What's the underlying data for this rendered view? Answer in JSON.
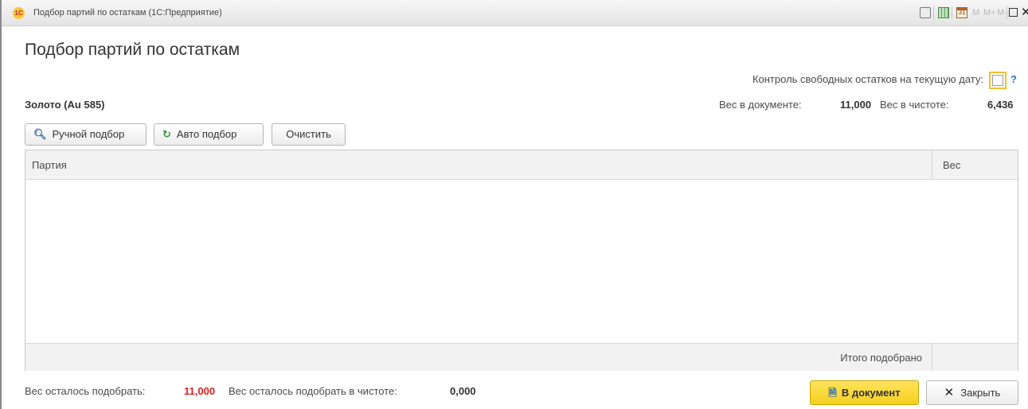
{
  "window": {
    "app_icon": "1С",
    "title": "Подбор партий по остаткам  (1С:Предприятие)",
    "icons": [
      "print-icon",
      "calculator-icon",
      "calendar-icon",
      "maximize-icon",
      "close-icon"
    ],
    "calendar_day": "31",
    "memory_buttons": [
      "M",
      "M+",
      "M-"
    ]
  },
  "form": {
    "title": "Подбор партий по остаткам",
    "control_label": "Контроль свободных остатков на текущую дату:",
    "control_checked": false,
    "help": "?",
    "metal": "Золото (Au 585)",
    "doc_weight_label": "Вес в документе:",
    "doc_weight_value": "11,000",
    "net_weight_label": "Вес в чистоте:",
    "net_weight_value": "6,436"
  },
  "toolbar": {
    "manual_label": "Ручной подбор",
    "auto_label": "Авто подбор",
    "clear_label": "Очистить"
  },
  "table": {
    "columns": [
      "Партия",
      "Вес"
    ],
    "rows": [],
    "footer_label": "Итого подобрано"
  },
  "bottom": {
    "remaining_label": "Вес осталось подобрать:",
    "remaining_value": "11,000",
    "remaining_net_label": "Вес осталось подобрать в чистоте:",
    "remaining_net_value": "0,000",
    "to_doc_label": "В документ",
    "close_label": "Закрыть"
  },
  "colors": {
    "accent_yellow": "#f6cf1e",
    "warning_red": "#e02020",
    "help_blue": "#2d72c8"
  }
}
